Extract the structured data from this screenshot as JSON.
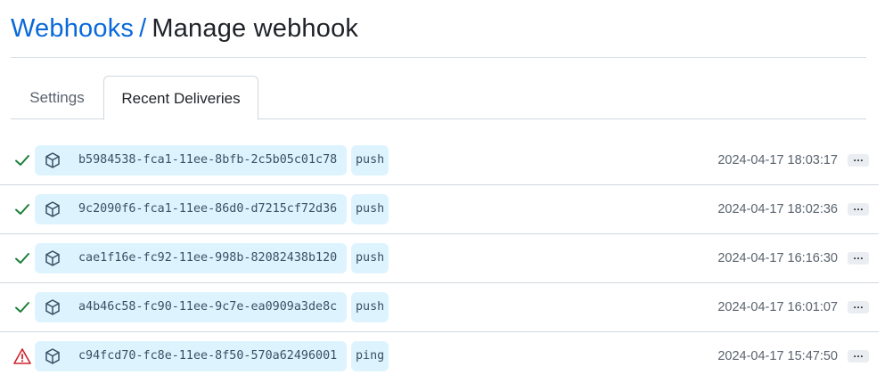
{
  "breadcrumb": {
    "parent": "Webhooks",
    "separator": "/",
    "current": "Manage webhook"
  },
  "tabs": [
    {
      "label": "Settings",
      "selected": false
    },
    {
      "label": "Recent Deliveries",
      "selected": true
    }
  ],
  "deliveries": [
    {
      "status": "success",
      "status_icon": "check-icon",
      "guid": "b5984538-fca1-11ee-8bfb-2c5b05c01c78",
      "event": "push",
      "timestamp": "2024-04-17 18:03:17",
      "more": "…"
    },
    {
      "status": "success",
      "status_icon": "check-icon",
      "guid": "9c2090f6-fca1-11ee-86d0-d7215cf72d36",
      "event": "push",
      "timestamp": "2024-04-17 18:02:36",
      "more": "…"
    },
    {
      "status": "success",
      "status_icon": "check-icon",
      "guid": "cae1f16e-fc92-11ee-998b-82082438b120",
      "event": "push",
      "timestamp": "2024-04-17 16:16:30",
      "more": "…"
    },
    {
      "status": "success",
      "status_icon": "check-icon",
      "guid": "a4b46c58-fc90-11ee-9c7e-ea0909a3de8c",
      "event": "push",
      "timestamp": "2024-04-17 16:01:07",
      "more": "…"
    },
    {
      "status": "failure",
      "status_icon": "alert-icon",
      "guid": "c94fcd70-fc8e-11ee-8f50-570a62496001",
      "event": "ping",
      "timestamp": "2024-04-17 15:47:50",
      "more": "…"
    }
  ],
  "colors": {
    "link": "#0969da",
    "success": "#1a7f37",
    "danger": "#cf222e",
    "pill_bg": "#ddf4ff"
  }
}
